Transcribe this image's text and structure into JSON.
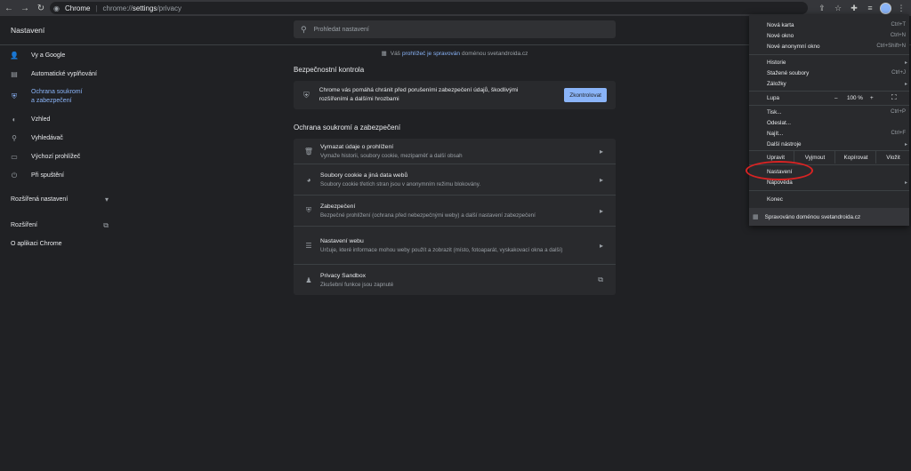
{
  "browser": {
    "site_label": "Chrome",
    "url_scheme": "chrome://",
    "url_path_bold": "settings",
    "url_path_rest": "/privacy",
    "icons": {
      "back": "←",
      "forward": "→",
      "reload": "↻",
      "site": "◉",
      "share": "⇪",
      "star": "☆",
      "extensions": "✚",
      "reading_list": "≡",
      "menu": "⋮"
    }
  },
  "header": {
    "title": "Nastavení",
    "search_icon": "⚲",
    "search_placeholder": "Prohledat nastavení"
  },
  "sidebar": {
    "items": [
      {
        "icon": "👤",
        "label": "Vy a Google"
      },
      {
        "icon": "▤",
        "label": "Automatické vyplňování"
      },
      {
        "icon": "⛨",
        "label1": "Ochrana soukromí",
        "label2": "a zabezpečení",
        "active": true
      },
      {
        "icon": "◐",
        "label": "Vzhled"
      },
      {
        "icon": "⚲",
        "label": "Vyhledávač"
      },
      {
        "icon": "▭",
        "label": "Výchozí prohlížeč"
      },
      {
        "icon": "⏻",
        "label": "Při spuštění"
      }
    ],
    "advanced": {
      "label": "Rozšířená nastavení",
      "icon": "▾"
    },
    "extensions": {
      "label": "Rozšíření",
      "icon": "⧉"
    },
    "about": {
      "label": "O aplikaci Chrome"
    }
  },
  "main": {
    "managed_prefix": "Váš",
    "managed_link": "prohlížeč je spravován",
    "managed_suffix": "doménou svetandroida.cz",
    "managed_icon": "▦",
    "safety_title": "Bezpečnostní kontrola",
    "safety_text": "Chrome vás pomáhá chránit před porušeními zabezpečení údajů, škodlivými rozšířeními a dalšími hrozbami",
    "safety_icon": "⛨",
    "safety_button": "Zkontrolovat",
    "privacy_title": "Ochrana soukromí a zabezpečení",
    "rows": [
      {
        "icon": "🗑",
        "title": "Vymazat údaje o prohlížení",
        "desc": "Vymaže historii, soubory cookie, mezipaměť a další obsah",
        "chev": "▸"
      },
      {
        "icon": "◕",
        "title": "Soubory cookie a jiná data webů",
        "desc": "Soubory cookie třetích stran jsou v anonymním režimu blokovány.",
        "chev": "▸"
      },
      {
        "icon": "⛨",
        "title": "Zabezpečení",
        "desc": "Bezpečné prohlížení (ochrana před nebezpečnými weby) a další nastavení zabezpečení",
        "chev": "▸"
      },
      {
        "icon": "☰",
        "title": "Nastavení webu",
        "desc": "Určuje, které informace mohou weby použít a zobrazit (místo, fotoaparát, vyskakovací okna a další)",
        "chev": "▸"
      },
      {
        "icon": "♟",
        "title": "Privacy Sandbox",
        "desc": "Zkušební funkce jsou zapnuté",
        "chev": "⧉"
      }
    ]
  },
  "menu": {
    "new_tab": {
      "label": "Nová karta",
      "shortcut": "Ctrl+T"
    },
    "new_window": {
      "label": "Nové okno",
      "shortcut": "Ctrl+N"
    },
    "new_incognito": {
      "label": "Nové anonymní okno",
      "shortcut": "Ctrl+Shift+N"
    },
    "history": {
      "label": "Historie",
      "arrow": "▸"
    },
    "downloads": {
      "label": "Stažené soubory",
      "shortcut": "Ctrl+J"
    },
    "bookmarks": {
      "label": "Záložky",
      "arrow": "▸"
    },
    "zoom": {
      "label": "Lupa",
      "minus": "–",
      "value": "100 %",
      "plus": "+",
      "fullscreen": "⛶"
    },
    "print": {
      "label": "Tisk...",
      "shortcut": "Ctrl+P"
    },
    "cast": {
      "label": "Odeslat..."
    },
    "find": {
      "label": "Najít...",
      "shortcut": "Ctrl+F"
    },
    "more_tools": {
      "label": "Další nástroje",
      "arrow": "▸"
    },
    "edit": {
      "label": "Upravit",
      "cut": "Vyjmout",
      "copy": "Kopírovat",
      "paste": "Vložit"
    },
    "settings": {
      "label": "Nastavení"
    },
    "help": {
      "label": "Nápověda",
      "arrow": "▸"
    },
    "exit": {
      "label": "Konec"
    },
    "managed": {
      "icon": "▦",
      "label": "Spravováno doménou svetandroida.cz"
    }
  },
  "colors": {
    "accent": "#8ab4f8",
    "background": "#202124",
    "card": "#292a2d",
    "annotation_red": "#d92323"
  }
}
